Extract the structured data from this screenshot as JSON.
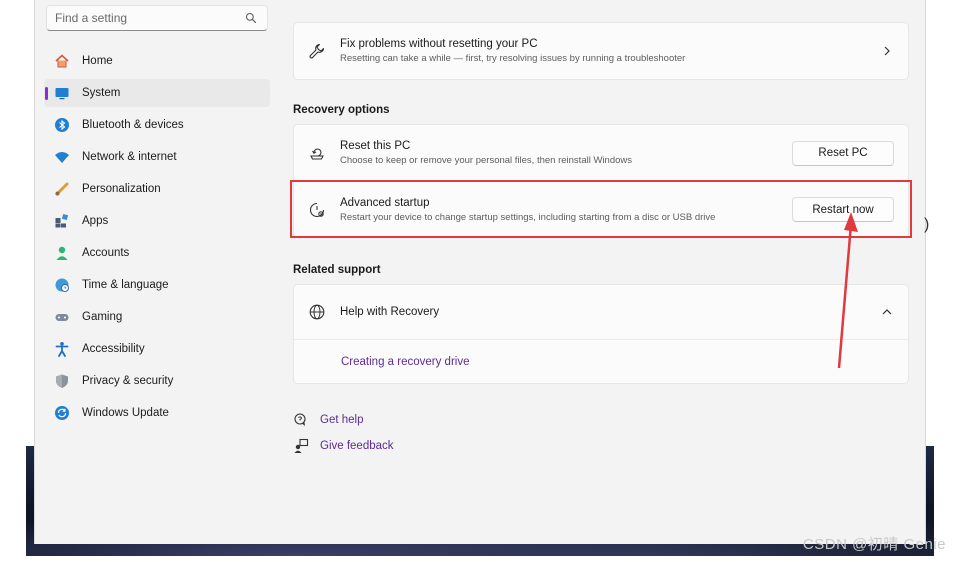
{
  "search": {
    "placeholder": "Find a setting"
  },
  "sidebar": {
    "items": [
      {
        "label": "Home",
        "icon": "home-icon"
      },
      {
        "label": "System",
        "icon": "system-icon",
        "active": true
      },
      {
        "label": "Bluetooth & devices",
        "icon": "bluetooth-icon"
      },
      {
        "label": "Network & internet",
        "icon": "wifi-icon"
      },
      {
        "label": "Personalization",
        "icon": "brush-icon"
      },
      {
        "label": "Apps",
        "icon": "apps-icon"
      },
      {
        "label": "Accounts",
        "icon": "account-icon"
      },
      {
        "label": "Time & language",
        "icon": "globe-clock-icon"
      },
      {
        "label": "Gaming",
        "icon": "gamepad-icon"
      },
      {
        "label": "Accessibility",
        "icon": "accessibility-icon"
      },
      {
        "label": "Privacy & security",
        "icon": "shield-icon"
      },
      {
        "label": "Windows Update",
        "icon": "update-icon"
      }
    ]
  },
  "main": {
    "fix_card": {
      "title": "Fix problems without resetting your PC",
      "subtitle": "Resetting can take a while — first, try resolving issues by running a troubleshooter"
    },
    "recovery_options_title": "Recovery options",
    "reset": {
      "title": "Reset this PC",
      "subtitle": "Choose to keep or remove your personal files, then reinstall Windows",
      "button": "Reset PC"
    },
    "advanced": {
      "title": "Advanced startup",
      "subtitle": "Restart your device to change startup settings, including starting from a disc or USB drive",
      "button": "Restart now"
    },
    "related_support_title": "Related support",
    "help": {
      "title": "Help with Recovery",
      "link": "Creating a recovery drive"
    },
    "footer": {
      "get_help": "Get help",
      "give_feedback": "Give feedback"
    }
  },
  "watermark": "CSDN @初晴 Genie",
  "colors": {
    "accent": "#8a2be2",
    "link": "#5c2d91",
    "highlight": "#e0393e"
  }
}
